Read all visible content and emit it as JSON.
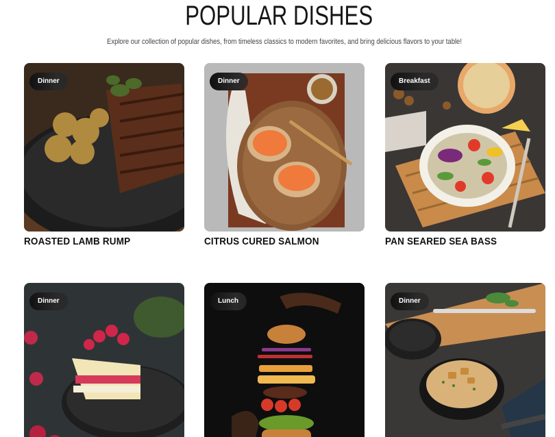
{
  "header": {
    "title": "POPULAR DISHES",
    "subtitle": "Explore our collection of popular dishes, from timeless classics to modern favorites, and bring delicious flavors to your table!"
  },
  "dishes": [
    {
      "category": "Dinner",
      "name": "ROASTED LAMB RUMP"
    },
    {
      "category": "Dinner",
      "name": "CITRUS CURED SALMON"
    },
    {
      "category": "Breakfast",
      "name": "PAN SEARED SEA BASS"
    },
    {
      "category": "Dinner",
      "name": ""
    },
    {
      "category": "Lunch",
      "name": ""
    },
    {
      "category": "Dinner",
      "name": ""
    }
  ]
}
